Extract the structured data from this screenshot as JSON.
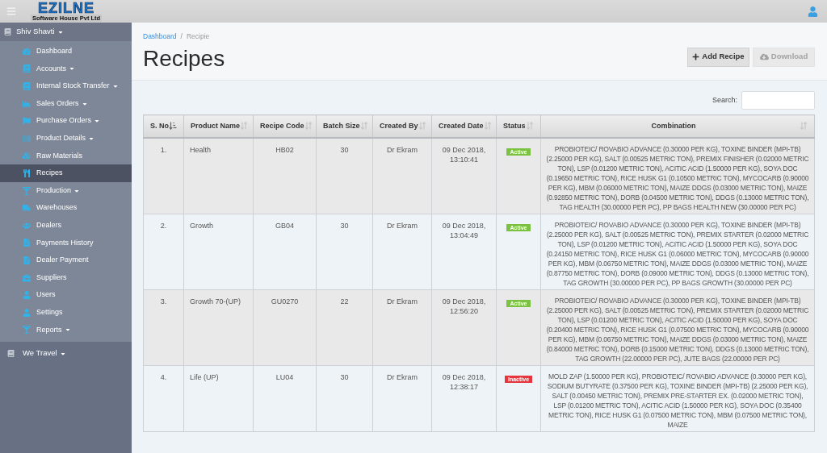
{
  "header": {
    "logo": {
      "name": "EZILNE",
      "tagline": "Software House Pvt Ltd"
    }
  },
  "sidebar": {
    "groups": [
      {
        "title": "Shiv Shavti",
        "expanded": true,
        "items": [
          {
            "label": "Dashboard",
            "submenu": false,
            "selected": false
          },
          {
            "label": "Accounts",
            "submenu": true,
            "selected": false
          },
          {
            "label": "Internal Stock Transfer",
            "submenu": true,
            "selected": false
          },
          {
            "label": "Sales Orders",
            "submenu": true,
            "selected": false
          },
          {
            "label": "Purchase Orders",
            "submenu": true,
            "selected": false
          },
          {
            "label": "Product Details",
            "submenu": true,
            "selected": false
          },
          {
            "label": "Raw Materials",
            "submenu": false,
            "selected": false
          },
          {
            "label": "Recipes",
            "submenu": false,
            "selected": true
          },
          {
            "label": "Production",
            "submenu": true,
            "selected": false
          },
          {
            "label": "Warehouses",
            "submenu": false,
            "selected": false
          },
          {
            "label": "Dealers",
            "submenu": false,
            "selected": false
          },
          {
            "label": "Payments History",
            "submenu": false,
            "selected": false
          },
          {
            "label": "Dealer Payment",
            "submenu": false,
            "selected": false
          },
          {
            "label": "Suppliers",
            "submenu": false,
            "selected": false
          },
          {
            "label": "Users",
            "submenu": false,
            "selected": false
          },
          {
            "label": "Settings",
            "submenu": false,
            "selected": false
          },
          {
            "label": "Reports",
            "submenu": true,
            "selected": false
          }
        ]
      },
      {
        "title": "We Travel",
        "expanded": false
      }
    ]
  },
  "breadcrumb": {
    "separator": "/",
    "items": [
      {
        "label": "Dashboard",
        "current": false
      },
      {
        "label": "Recipie",
        "current": true
      }
    ]
  },
  "page_title": "Recipes",
  "actions": [
    {
      "label": "Add Recipe",
      "kind": "add",
      "disabled": false
    },
    {
      "label": "Download",
      "kind": "download",
      "disabled": true
    }
  ],
  "search": {
    "label": "Search:"
  },
  "table": {
    "columns": [
      {
        "label": "S. No",
        "sorted": true
      },
      {
        "label": "Product Name",
        "sorted": false
      },
      {
        "label": "Recipe Code",
        "sorted": false
      },
      {
        "label": "Batch Size",
        "sorted": false
      },
      {
        "label": "Created By",
        "sorted": false
      },
      {
        "label": "Created Date",
        "sorted": false
      },
      {
        "label": "Status",
        "sorted": false
      },
      {
        "label": "Combination",
        "sorted": false
      }
    ],
    "rows": [
      {
        "s_no": "1.",
        "product_name": "Health",
        "recipe_code": "HB02",
        "batch_size": "30",
        "created_by": "Dr Ekram",
        "created_date": "09 Dec 2018, 13:10:41",
        "status": {
          "label": "Active",
          "color": "#7cc242"
        },
        "combination": "PROBIOTEIC/ ROVABIO ADVANCE (0.30000 PER KG), TOXINE BINDER (MPI-TB) (2.25000 PER KG), SALT (0.00525 METRIC TON), PREMIX FINISHER (0.02000 METRIC TON), LSP (0.01200 METRIC TON), ACITIC ACID (1.50000 PER KG), SOYA DOC (0.19650 METRIC TON), RICE HUSK G1 (0.10500 METRIC TON), MYCOCARB (0.90000 PER KG), MBM (0.06000 METRIC TON), MAIZE DDGS (0.03000 METRIC TON), MAIZE (0.92850 METRIC TON), DORB (0.04500 METRIC TON), DDGS (0.13000 METRIC TON), TAG HEALTH (30.00000 PER PC), PP BAGS HEALTH NEW (30.00000 PER PC)"
      },
      {
        "s_no": "2.",
        "product_name": "Growth",
        "recipe_code": "GB04",
        "batch_size": "30",
        "created_by": "Dr Ekram",
        "created_date": "09 Dec 2018, 13:04:49",
        "status": {
          "label": "Active",
          "color": "#7cc242"
        },
        "combination": "PROBIOTEIC/ ROVABIO ADVANCE (0.30000 PER KG), TOXINE BINDER (MPI-TB) (2.25000 PER KG), SALT (0.00525 METRIC TON), PREMIX STARTER (0.02000 METRIC TON), LSP (0.01200 METRIC TON), ACITIC ACID (1.50000 PER KG), SOYA DOC (0.24150 METRIC TON), RICE HUSK G1 (0.06000 METRIC TON), MYCOCARB (0.90000 PER KG), MBM (0.06750 METRIC TON), MAIZE DDGS (0.03000 METRIC TON), MAIZE (0.87750 METRIC TON), DORB (0.09000 METRIC TON), DDGS (0.13000 METRIC TON), TAG GROWTH (30.00000 PER PC), PP BAGS GROWTH (30.00000 PER PC)"
      },
      {
        "s_no": "3.",
        "product_name": "Growth 70-(UP)",
        "recipe_code": "GU0270",
        "batch_size": "22",
        "created_by": "Dr Ekram",
        "created_date": "09 Dec 2018, 12:56:20",
        "status": {
          "label": "Active",
          "color": "#7cc242"
        },
        "combination": "PROBIOTEIC/ ROVABIO ADVANCE (0.30000 PER KG), TOXINE BINDER (MPI-TB) (2.25000 PER KG), SALT (0.00525 METRIC TON), PREMIX STARTER (0.02000 METRIC TON), LSP (0.01200 METRIC TON), ACITIC ACID (1.50000 PER KG), SOYA DOC (0.20400 METRIC TON), RICE HUSK G1 (0.07500 METRIC TON), MYCOCARB (0.90000 PER KG), MBM (0.06750 METRIC TON), MAIZE DDGS (0.03000 METRIC TON), MAIZE (0.84000 METRIC TON), DORB (0.15000 METRIC TON), DDGS (0.13000 METRIC TON), TAG GROWTH (22.00000 PER PC), JUTE BAGS (22.00000 PER PC)"
      },
      {
        "s_no": "4.",
        "product_name": "Life (UP)",
        "recipe_code": "LU04",
        "batch_size": "30",
        "created_by": "Dr Ekram",
        "created_date": "09 Dec 2018, 12:38:17",
        "status": {
          "label": "Inactive",
          "color": "#e8343c"
        },
        "combination": "MOLD ZAP (1.50000 PER KG), PROBIOTEIC/ ROVABIO ADVANCE (0.30000 PER KG), SODIUM BUTYRATE (0.37500 PER KG), TOXINE BINDER (MPI-TB) (2.25000 PER KG), SALT (0.00450 METRIC TON), PREMIX PRE-STARTER EX. (0.02000 METRIC TON), LSP (0.01200 METRIC TON), ACITIC ACID (1.50000 PER KG), SOYA DOC (0.35400 METRIC TON), RICE HUSK G1 (0.07500 METRIC TON), MBM (0.07500 METRIC TON), MAIZE"
      }
    ]
  }
}
